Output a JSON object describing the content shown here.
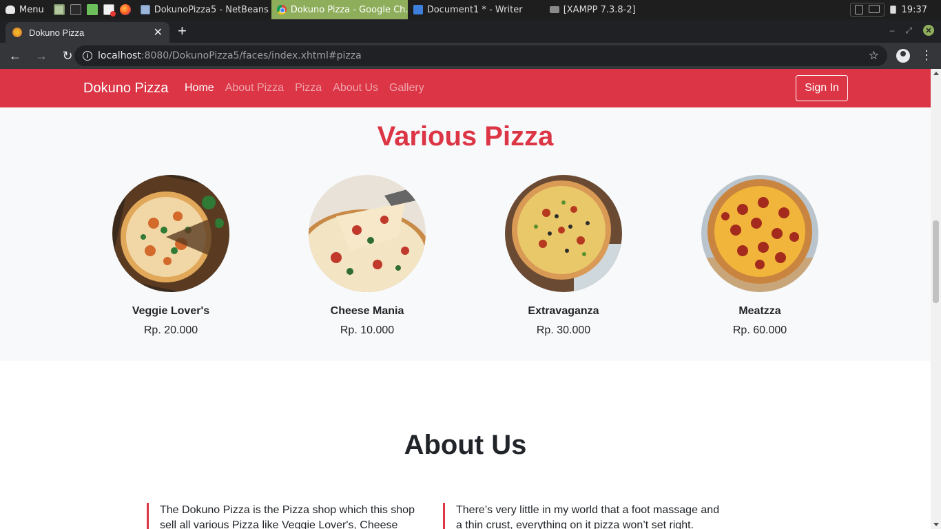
{
  "taskbar": {
    "menu_label": "Menu",
    "tasks": [
      {
        "label": "DokunoPizza5 - NetBeans ..."
      },
      {
        "label": "Dokuno Pizza - Google Ch..."
      },
      {
        "label": "Document1 * - Writer"
      },
      {
        "label": "[XAMPP 7.3.8-2]"
      }
    ],
    "clock": "19:37"
  },
  "browser": {
    "tab_title": "Dokuno Pizza",
    "url_host": "localhost",
    "url_rest": ":8080/DokunoPizza5/faces/index.xhtml#pizza"
  },
  "navbar": {
    "brand": "Dokuno Pizza",
    "links": [
      {
        "label": "Home",
        "active": true
      },
      {
        "label": "About Pizza"
      },
      {
        "label": "Pizza"
      },
      {
        "label": "About Us"
      },
      {
        "label": "Gallery"
      }
    ],
    "signin_label": "Sign In",
    "color": "#dc3545"
  },
  "pizza_section": {
    "title": "Various Pizza",
    "items": [
      {
        "name": "Veggie Lover's",
        "price": "Rp. 20.000"
      },
      {
        "name": "Cheese Mania",
        "price": "Rp. 10.000"
      },
      {
        "name": "Extravaganza",
        "price": "Rp. 30.000"
      },
      {
        "name": "Meatzza",
        "price": "Rp. 60.000"
      }
    ]
  },
  "about_section": {
    "title": "About Us",
    "col1": "The Dokuno Pizza is the Pizza shop which this shop sell all various Pizza like Veggie Lover's, Cheese",
    "col2": "There’s very little in my world that a foot massage and a thin crust, everything on it pizza won’t set right. There’s"
  }
}
